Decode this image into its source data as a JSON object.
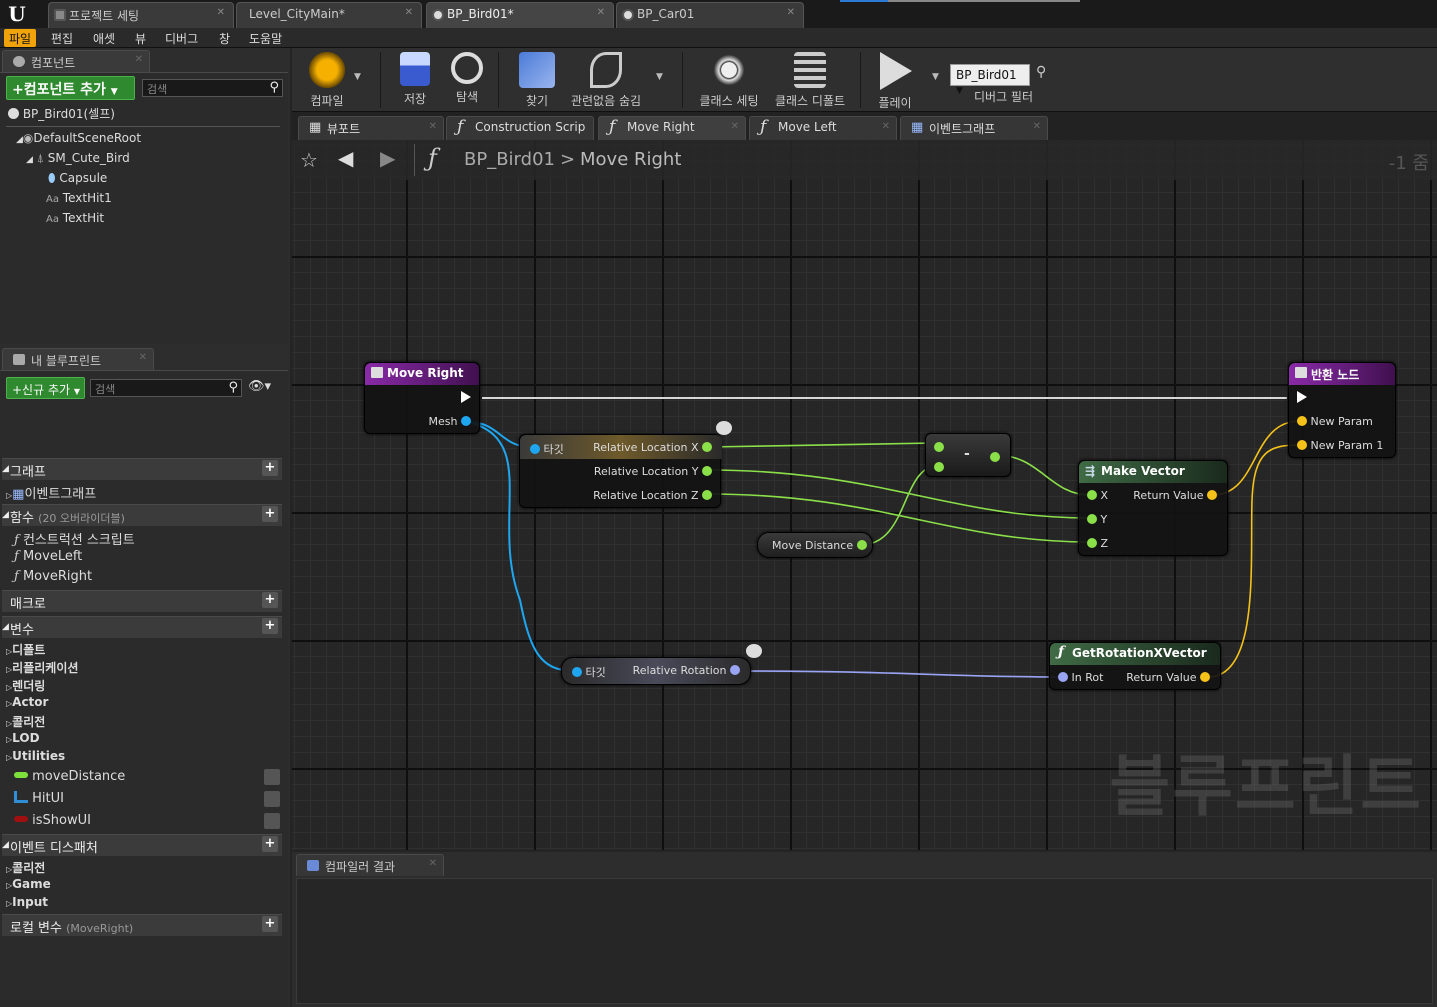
{
  "window": {
    "tabs": [
      {
        "label": "프로젝트 세팅"
      },
      {
        "label": "Level_CityMain*"
      },
      {
        "label": "BP_Bird01*"
      },
      {
        "label": "BP_Car01"
      }
    ]
  },
  "menu": [
    "파일",
    "편집",
    "애셋",
    "뷰",
    "디버그",
    "창",
    "도움말"
  ],
  "components_panel": {
    "tab": "컴포넌트",
    "add_button": "+컴포넌트 추가",
    "search_placeholder": "검색",
    "self_item": "BP_Bird01(셀프)",
    "tree": [
      "DefaultSceneRoot",
      "SM_Cute_Bird",
      "Capsule",
      "TextHit1",
      "TextHit"
    ]
  },
  "my_blueprint": {
    "tab": "내 블루프린트",
    "add_button": "+신규 추가",
    "search_placeholder": "검색",
    "graphs_header": "그래프",
    "graphs": [
      "이벤트그래프"
    ],
    "functions_header": "함수",
    "functions_override": "(20 오버라이더블)",
    "functions": [
      "컨스트럭션 스크립트",
      "MoveLeft",
      "MoveRight"
    ],
    "macros_header": "매크로",
    "variables_header": "변수",
    "variable_categories": [
      "디폴트",
      "리플리케이션",
      "렌더링",
      "Actor",
      "콜리전",
      "LOD",
      "Utilities"
    ],
    "variables": [
      {
        "name": "moveDistance",
        "color": "#7ee03a"
      },
      {
        "name": "HitUI",
        "color": "#2f8ed6"
      },
      {
        "name": "isShowUI",
        "color": "#a01010"
      }
    ],
    "dispatchers_header": "이벤트 디스패처",
    "dispatcher_categories": [
      "콜리전",
      "Game",
      "Input"
    ],
    "local_vars_header": "로컬 변수",
    "local_vars_scope": "(MoveRight)"
  },
  "toolbar": {
    "buttons": [
      "컴파일",
      "저장",
      "탐색",
      "찾기",
      "관련없음 숨김",
      "클래스 세팅",
      "클래스 디폴트",
      "플레이"
    ],
    "debug_object": "BP_Bird01",
    "debug_filter": "디버그 필터"
  },
  "editor_tabs": [
    "뷰포트",
    "Construction Scrip",
    "Move Right",
    "Move Left",
    "이벤트그래프"
  ],
  "breadcrumb": {
    "blueprint": "BP_Bird01",
    "separator": ">",
    "function": "Move Right",
    "zoom": "-1 줌"
  },
  "nodes": {
    "entry": {
      "title": "Move Right",
      "pin": "Mesh"
    },
    "get_location": {
      "target": "타깃",
      "x": "Relative Location X",
      "y": "Relative Location Y",
      "z": "Relative Location Z"
    },
    "subtract": {
      "symbol": "-"
    },
    "move_distance": {
      "label": "Move Distance"
    },
    "make_vector": {
      "title": "Make Vector",
      "x": "X",
      "y": "Y",
      "z": "Z",
      "ret": "Return Value"
    },
    "get_rotation": {
      "target": "타깃",
      "out": "Relative Rotation"
    },
    "rot_x_vector": {
      "title": "GetRotationXVector",
      "in": "In Rot",
      "ret": "Return Value"
    },
    "return": {
      "title": "반환 노드",
      "p1": "New Param",
      "p2": "New Param 1"
    }
  },
  "watermark": "블루프린트",
  "compiler_tab": "컴파일러 결과",
  "colors": {
    "accent": "#f0a30a",
    "exec": "#ffffff",
    "float": "#8be04a",
    "object": "#1fa6f0",
    "vector": "#f5c21a",
    "rotator": "#9aa4f5"
  }
}
